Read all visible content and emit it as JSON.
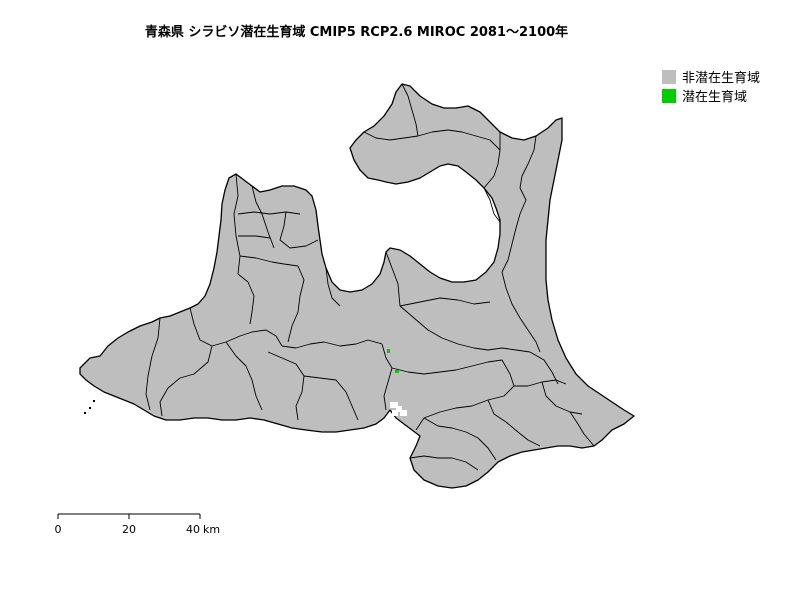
{
  "title": "青森県 シラビソ潜在生育域 CMIP5 RCP2.6 MIROC 2081～2100年",
  "legend": {
    "items": [
      {
        "label": "非潜在生育域",
        "color": "#bebebe"
      },
      {
        "label": "潜在生育域",
        "color": "#00cc00"
      }
    ]
  },
  "scalebar": {
    "ticks": [
      "0",
      "20",
      "40"
    ],
    "unit": "km"
  },
  "colors": {
    "land": "#bebebe",
    "border": "#000000",
    "potential": "#00cc00",
    "nodata": "#ffffff"
  }
}
